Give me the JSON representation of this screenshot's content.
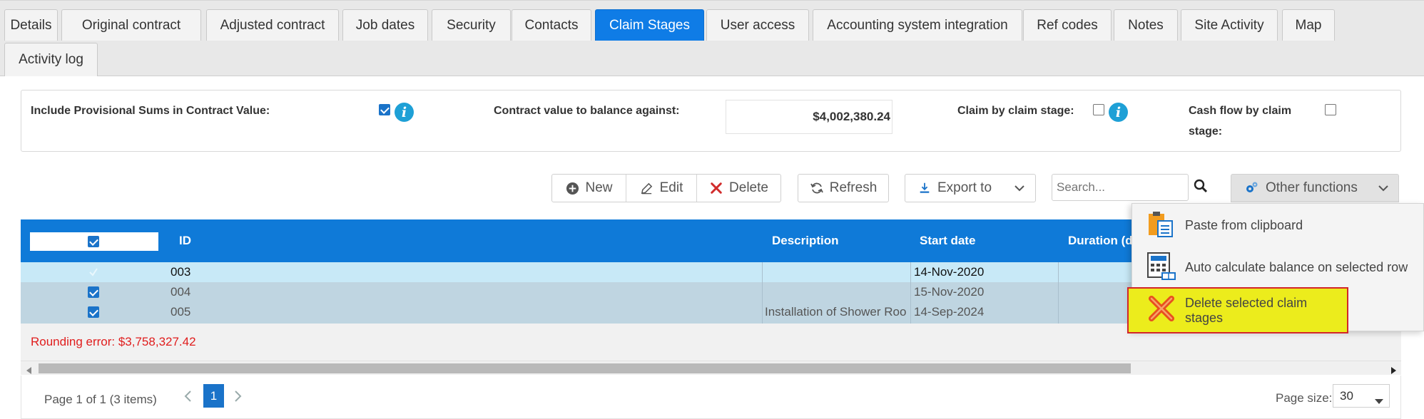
{
  "tabs": [
    {
      "label": "Details",
      "active": false
    },
    {
      "label": "Original contract",
      "active": false
    },
    {
      "label": "Adjusted contract",
      "active": false
    },
    {
      "label": "Job dates",
      "active": false
    },
    {
      "label": "Security",
      "active": false
    },
    {
      "label": "Contacts",
      "active": false
    },
    {
      "label": "Claim Stages",
      "active": true
    },
    {
      "label": "User access",
      "active": false
    },
    {
      "label": "Accounting system integration",
      "active": false
    },
    {
      "label": "Ref codes",
      "active": false
    },
    {
      "label": "Notes",
      "active": false
    },
    {
      "label": "Site Activity",
      "active": false
    },
    {
      "label": "Map",
      "active": false
    },
    {
      "label": "Activity log",
      "active": false
    }
  ],
  "settings": {
    "include_provisional_label": "Include Provisional Sums in Contract Value:",
    "include_provisional_checked": true,
    "contract_value_label": "Contract value to balance against:",
    "contract_value": "$4,002,380.24",
    "claim_by_stage_label": "Claim by claim stage:",
    "claim_by_stage_checked": false,
    "cash_flow_label_line1": "Cash flow by claim",
    "cash_flow_label_line2": "stage:",
    "cash_flow_checked": false
  },
  "toolbar": {
    "new_label": "New",
    "edit_label": "Edit",
    "delete_label": "Delete",
    "refresh_label": "Refresh",
    "export_label": "Export to",
    "search_placeholder": "Search...",
    "other_functions_label": "Other functions"
  },
  "grid": {
    "columns": {
      "id": "ID",
      "description": "Description",
      "start_date": "Start date",
      "duration": "Duration (d"
    },
    "rows": [
      {
        "id": "003",
        "description": "",
        "start_date": "14-Nov-2020",
        "checked": true
      },
      {
        "id": "004",
        "description": "",
        "start_date": "15-Nov-2020",
        "checked": true
      },
      {
        "id": "005",
        "description": "Installation of Shower Roo",
        "start_date": "14-Sep-2024",
        "checked": true
      }
    ],
    "rounding_error": "Rounding error: $3,758,327.42"
  },
  "pager": {
    "summary": "Page 1 of 1 (3 items)",
    "current_page": "1",
    "page_size_label": "Page size:",
    "page_size": "30"
  },
  "menu": {
    "items": [
      {
        "label": "Paste from clipboard",
        "icon": "clipboard-icon"
      },
      {
        "label": "Auto calculate balance on selected row",
        "icon": "calculator-icon"
      },
      {
        "label": "Delete selected claim stages",
        "icon": "delete-x-icon",
        "highlighted": true
      }
    ]
  },
  "colors": {
    "accent": "#0f7ce6",
    "header": "#0f7ad8",
    "selected_row": "#c8e9f7",
    "checked_row": "#bfd5e1",
    "error": "#e01d1d",
    "highlight": "#ecec1c",
    "highlight_border": "#d2262a"
  }
}
